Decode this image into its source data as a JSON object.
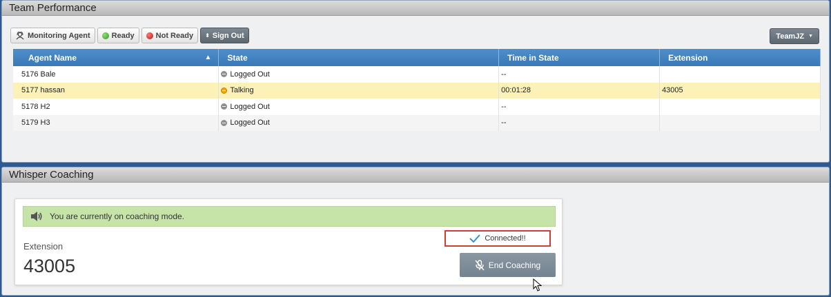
{
  "team_panel": {
    "title": "Team Performance",
    "toolbar": {
      "monitoring_label": "Monitoring Agent",
      "ready_label": "Ready",
      "not_ready_label": "Not Ready",
      "sign_out_label": "Sign Out"
    },
    "team_selector": "TeamJZ",
    "columns": [
      "Agent Name",
      "State",
      "Time in State",
      "Extension"
    ],
    "rows": [
      {
        "agent": "5176 Bale",
        "state": "Logged Out",
        "state_icon": "gray",
        "time": "--",
        "extension": ""
      },
      {
        "agent": "5177 hassan",
        "state": "Talking",
        "state_icon": "orange",
        "time": "00:01:28",
        "extension": "43005"
      },
      {
        "agent": "5178 H2",
        "state": "Logged Out",
        "state_icon": "gray",
        "time": "--",
        "extension": ""
      },
      {
        "agent": "5179 H3",
        "state": "Logged Out",
        "state_icon": "gray",
        "time": "--",
        "extension": ""
      }
    ]
  },
  "whisper_panel": {
    "title": "Whisper Coaching",
    "alert_text": "You are currently on coaching mode.",
    "extension_label": "Extension",
    "extension_value": "43005",
    "status_text": "Connected!!",
    "end_button_label": "End Coaching"
  },
  "colors": {
    "header_blue": "#3a78b7",
    "highlight_row": "#fcf2b8",
    "alert_green": "#c6e3a8",
    "connected_border": "#d33c32"
  }
}
